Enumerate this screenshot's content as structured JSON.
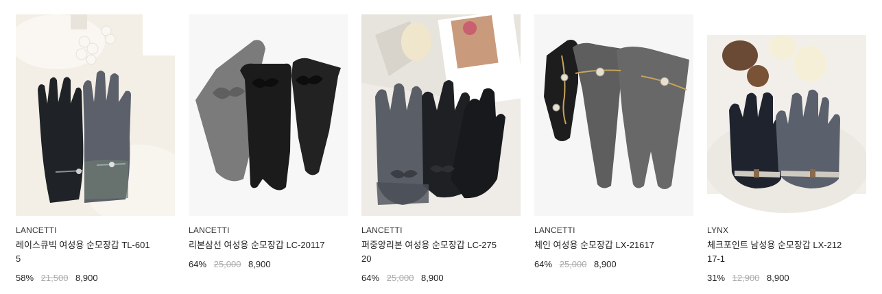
{
  "products": [
    {
      "brand": "LANCETTI",
      "name": "레이스큐빅 여성용 순모장갑 TL-6015",
      "discount": "58%",
      "original_price": "21,500",
      "sale_price": "8,900",
      "image_icon": "gloves-lace-product-image"
    },
    {
      "brand": "LANCETTI",
      "name": "리본삼선 여성용 순모장갑 LC-20117",
      "discount": "64%",
      "original_price": "25,000",
      "sale_price": "8,900",
      "image_icon": "gloves-ribbon-product-image"
    },
    {
      "brand": "LANCETTI",
      "name": "퍼중앙리본 여성용 순모장갑 LC-27520",
      "discount": "64%",
      "original_price": "25,000",
      "sale_price": "8,900",
      "image_icon": "gloves-fur-ribbon-product-image"
    },
    {
      "brand": "LANCETTI",
      "name": "체인 여성용 순모장갑 LX-21617",
      "discount": "64%",
      "original_price": "25,000",
      "sale_price": "8,900",
      "image_icon": "gloves-chain-product-image"
    },
    {
      "brand": "LYNX",
      "name": "체크포인트 남성용 순모장갑 LX-21217-1",
      "discount": "31%",
      "original_price": "12,900",
      "sale_price": "8,900",
      "image_icon": "gloves-check-point-product-image"
    }
  ]
}
